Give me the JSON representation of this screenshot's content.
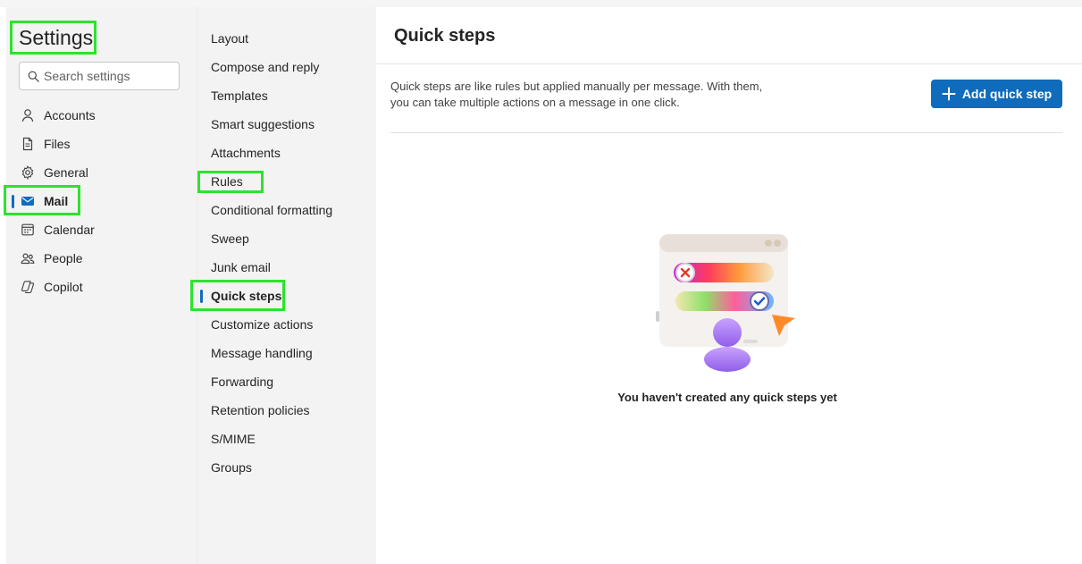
{
  "settings": {
    "title": "Settings",
    "search_placeholder": "Search settings"
  },
  "nav": {
    "items": [
      {
        "label": "Accounts",
        "icon": "person-icon"
      },
      {
        "label": "Files",
        "icon": "file-icon"
      },
      {
        "label": "General",
        "icon": "gear-icon"
      },
      {
        "label": "Mail",
        "icon": "mail-icon",
        "active": true
      },
      {
        "label": "Calendar",
        "icon": "calendar-icon"
      },
      {
        "label": "People",
        "icon": "people-icon"
      },
      {
        "label": "Copilot",
        "icon": "copilot-icon"
      }
    ]
  },
  "submenu": {
    "items": [
      {
        "label": "Layout"
      },
      {
        "label": "Compose and reply"
      },
      {
        "label": "Templates"
      },
      {
        "label": "Smart suggestions"
      },
      {
        "label": "Attachments"
      },
      {
        "label": "Rules"
      },
      {
        "label": "Conditional formatting"
      },
      {
        "label": "Sweep"
      },
      {
        "label": "Junk email"
      },
      {
        "label": "Quick steps",
        "active": true
      },
      {
        "label": "Customize actions"
      },
      {
        "label": "Message handling"
      },
      {
        "label": "Forwarding"
      },
      {
        "label": "Retention policies"
      },
      {
        "label": "S/MIME"
      },
      {
        "label": "Groups"
      }
    ]
  },
  "main": {
    "title": "Quick steps",
    "description": "Quick steps are like rules but applied manually per message. With them, you can take multiple actions on a message in one click.",
    "add_button_label": "Add quick step",
    "empty_message": "You haven't created any quick steps yet"
  },
  "colors": {
    "accent": "#0f6cbd",
    "highlight": "#2ee22e"
  }
}
